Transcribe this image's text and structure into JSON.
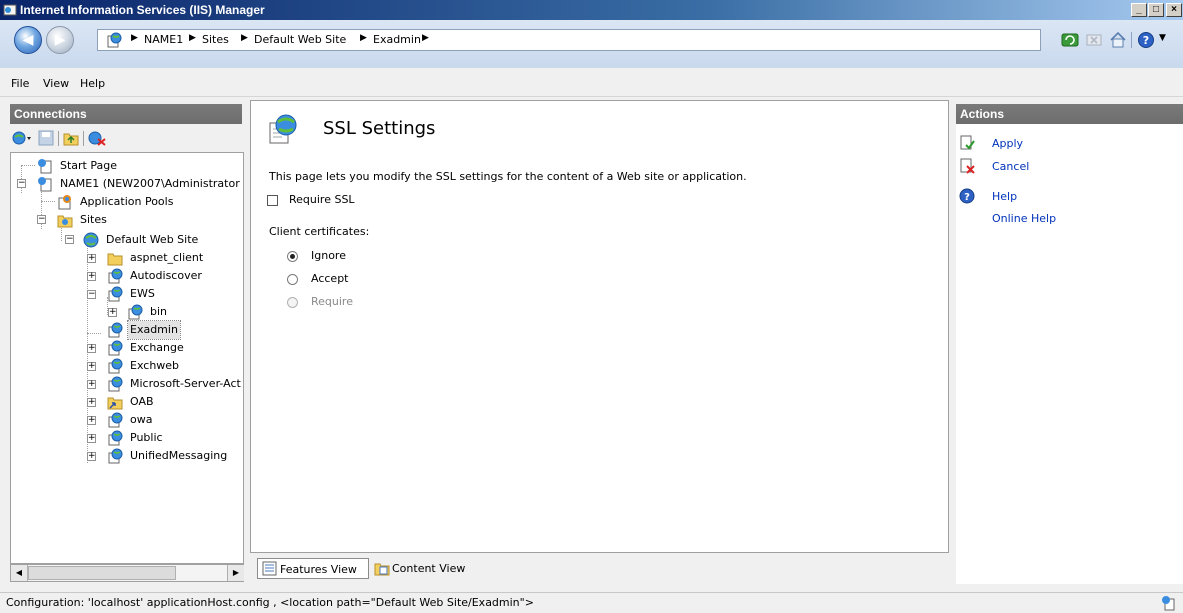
{
  "window": {
    "title": "Internet Information Services (IIS) Manager",
    "icon": "iis-manager-icon"
  },
  "address": {
    "crumbs": [
      "NAME1",
      "Sites",
      "Default Web Site",
      "Exadmin"
    ]
  },
  "menu": {
    "file": "File",
    "view": "View",
    "help": "Help"
  },
  "connections": {
    "header": "Connections",
    "tree": [
      {
        "label": "Start Page",
        "icon": "start-page-icon"
      },
      {
        "label": "NAME1 (NEW2007\\Administrator",
        "icon": "server-icon"
      },
      {
        "label": "Application Pools",
        "icon": "app-pools-icon"
      },
      {
        "label": "Sites",
        "icon": "sites-folder-icon"
      },
      {
        "label": "Default Web Site",
        "icon": "website-globe-icon"
      },
      {
        "label": "aspnet_client",
        "icon": "folder-icon"
      },
      {
        "label": "Autodiscover",
        "icon": "web-app-icon"
      },
      {
        "label": "EWS",
        "icon": "web-app-icon"
      },
      {
        "label": "bin",
        "icon": "web-app-icon"
      },
      {
        "label": "Exadmin",
        "icon": "web-app-icon"
      },
      {
        "label": "Exchange",
        "icon": "web-app-icon"
      },
      {
        "label": "Exchweb",
        "icon": "web-app-icon"
      },
      {
        "label": "Microsoft-Server-Act",
        "icon": "web-app-icon"
      },
      {
        "label": "OAB",
        "icon": "virtual-dir-icon"
      },
      {
        "label": "owa",
        "icon": "web-app-icon"
      },
      {
        "label": "Public",
        "icon": "web-app-icon"
      },
      {
        "label": "UnifiedMessaging",
        "icon": "web-app-icon"
      }
    ]
  },
  "main": {
    "title": "SSL Settings",
    "description": "This page lets you modify the SSL settings for the content of a Web site or application.",
    "require_ssl_label": "Require SSL",
    "require_ssl_checked": false,
    "client_cert_label": "Client certificates:",
    "options": [
      {
        "label": "Ignore",
        "selected": true,
        "enabled": true
      },
      {
        "label": "Accept",
        "selected": false,
        "enabled": true
      },
      {
        "label": "Require",
        "selected": false,
        "enabled": false
      }
    ]
  },
  "view_tabs": {
    "features": "Features View",
    "content": "Content View",
    "active": "features"
  },
  "actions": {
    "header": "Actions",
    "apply": "Apply",
    "cancel": "Cancel",
    "help": "Help",
    "online_help": "Online Help"
  },
  "status": {
    "text": "Configuration: 'localhost' applicationHost.config , <location path=\"Default Web Site/Exadmin\">"
  },
  "colors": {
    "titlebar": "#0a246a",
    "link": "#0033bb",
    "pane_header": "#707070"
  }
}
